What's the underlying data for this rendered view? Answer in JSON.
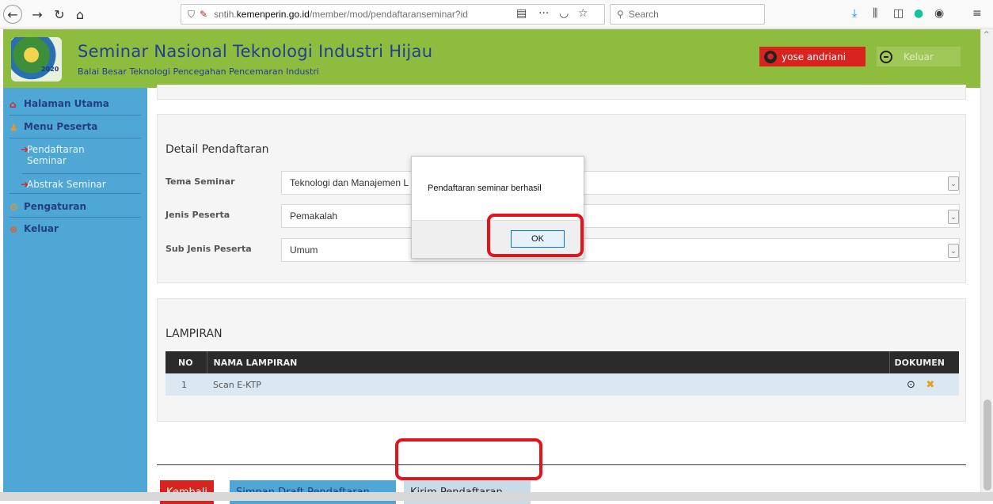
{
  "browser": {
    "url_prefix": "sntih.",
    "url_domain": "kemenperin.go.id",
    "url_path": "/member/mod/pendaftaranseminar?id",
    "search_placeholder": "Search"
  },
  "header": {
    "title": "Seminar Nasional Teknologi Industri Hijau",
    "subtitle": "Balai Besar Teknologi Pencegahan Pencemaran Industri",
    "logo_year": "2020",
    "user_name": "yose andriani",
    "logout_label": "Keluar"
  },
  "sidebar": {
    "items": [
      {
        "label": "Halaman Utama",
        "icon": "home-icon"
      },
      {
        "label": "Menu Peserta",
        "icon": "user-icon"
      },
      {
        "label": "Pengaturan",
        "icon": "gear-icon"
      },
      {
        "label": "Keluar",
        "icon": "exit-icon"
      }
    ],
    "sub_items": [
      {
        "label": "Pendaftaran Seminar"
      },
      {
        "label": "Abstrak Seminar"
      }
    ]
  },
  "detail": {
    "title": "Detail Pendaftaran",
    "fields": [
      {
        "label": "Tema Seminar",
        "value": "Teknologi dan Manajemen L"
      },
      {
        "label": "Jenis Peserta",
        "value": "Pemakalah"
      },
      {
        "label": "Sub Jenis Peserta",
        "value": "Umum"
      }
    ]
  },
  "lampiran": {
    "title": "LAMPIRAN",
    "columns": [
      "NO",
      "NAMA LAMPIRAN",
      "DOKUMEN"
    ],
    "rows": [
      {
        "no": "1",
        "nama": "Scan E-KTP"
      }
    ]
  },
  "buttons": {
    "back": "Kembali",
    "draft": "Simpan Draft Pendaftaran",
    "send": "Kirim Pendaftaran"
  },
  "dialog": {
    "message": "Pendaftaran seminar berhasil",
    "ok_label": "OK"
  },
  "colors": {
    "header_bg": "#8dbc3e",
    "sidebar_bg": "#4fa7d6",
    "title_blue": "#233e93",
    "danger_red": "#d9231f",
    "highlight_red": "#e4131b"
  }
}
